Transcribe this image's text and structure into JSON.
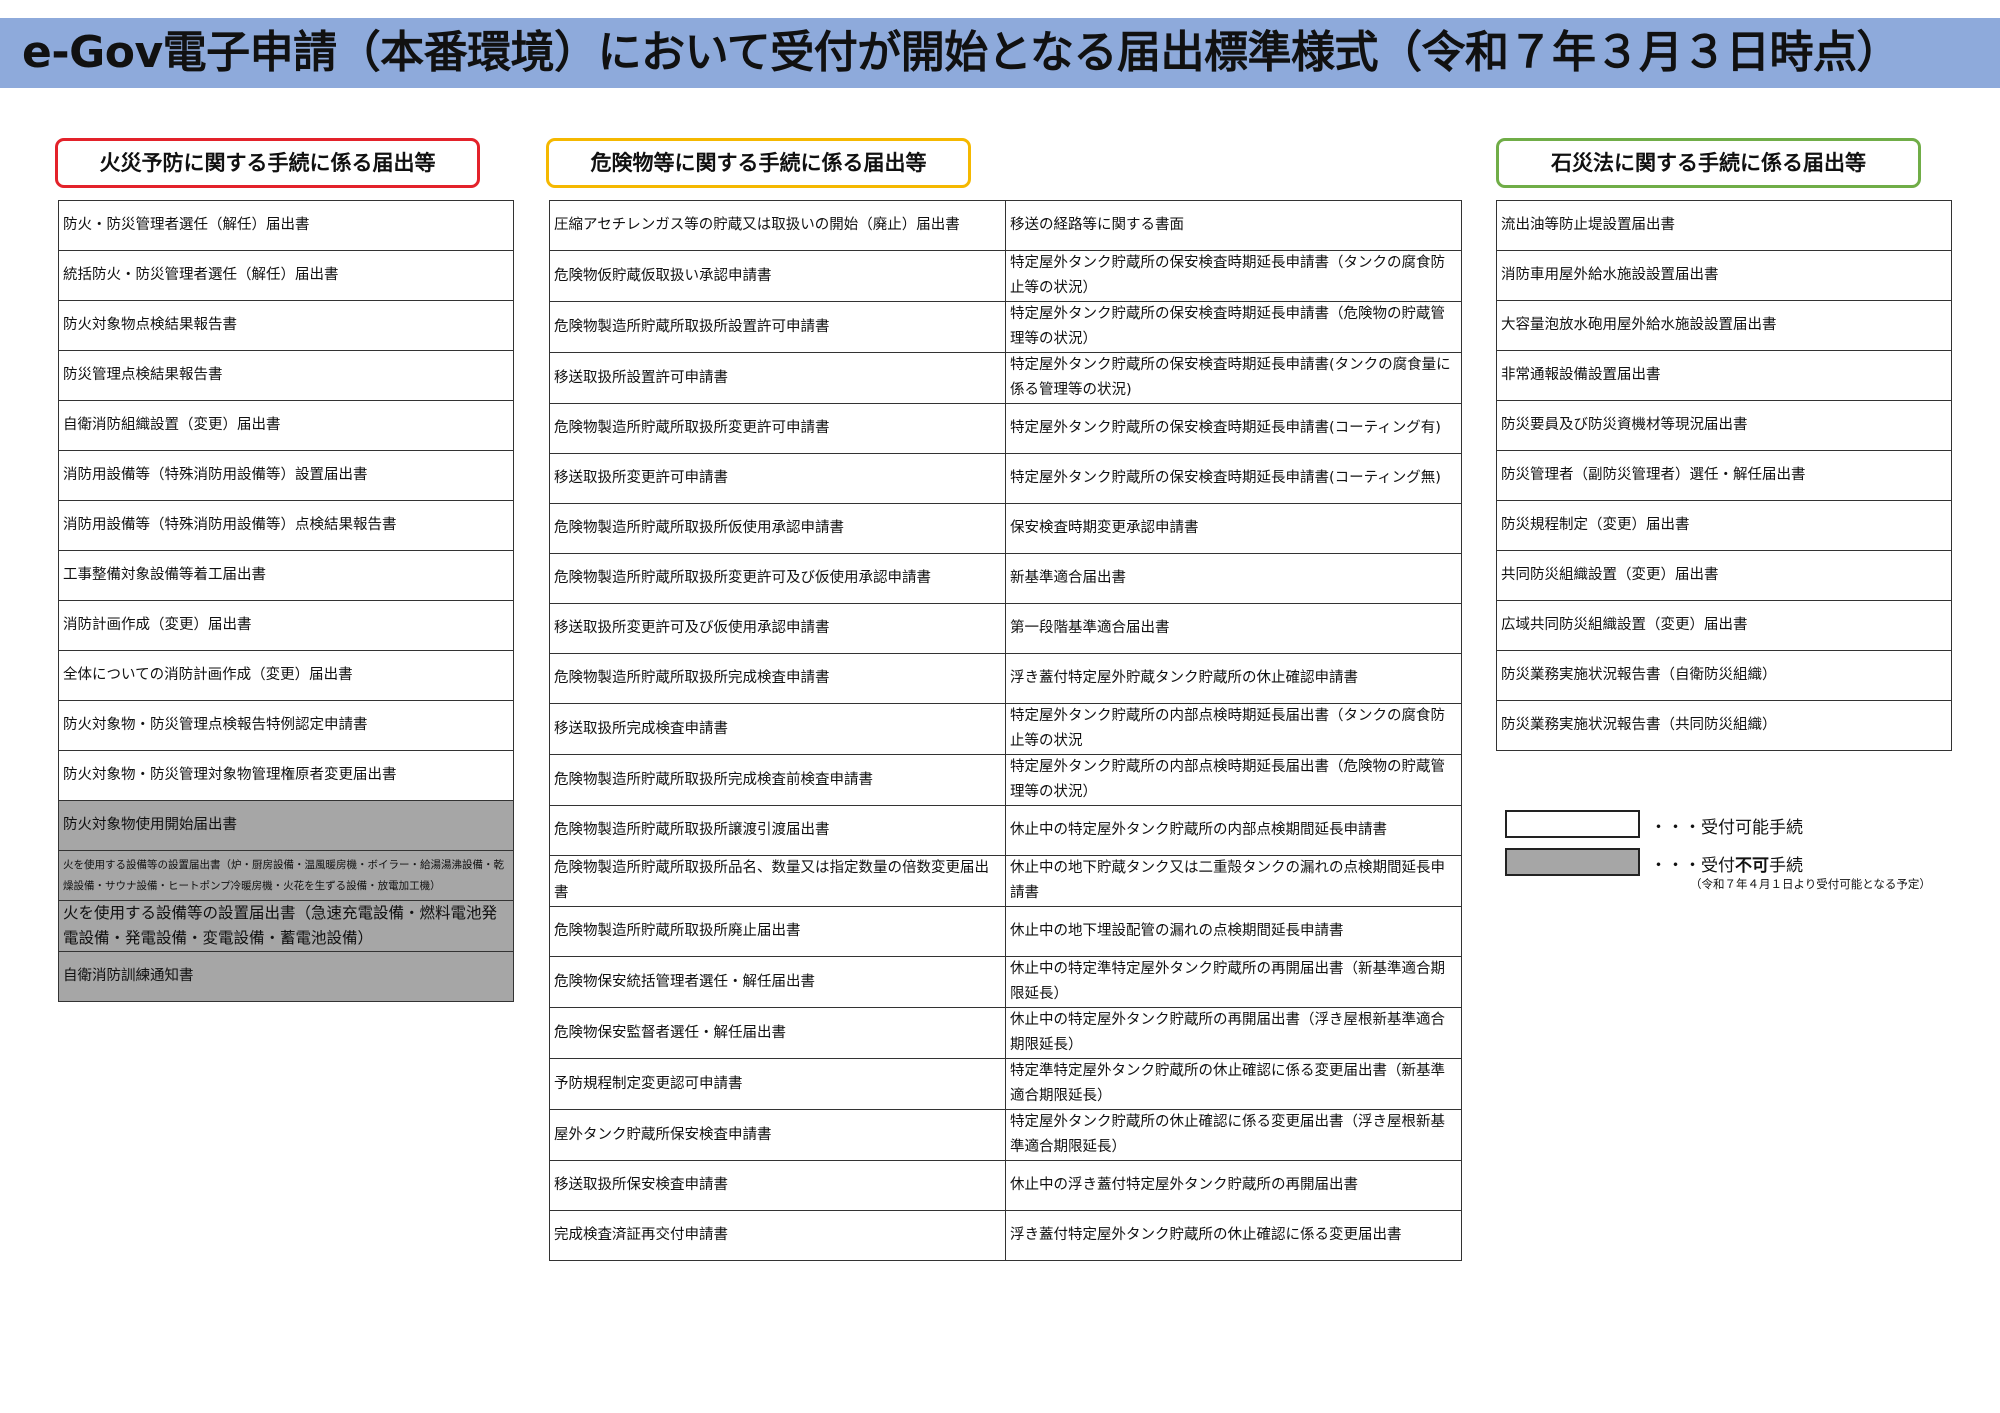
{
  "title": "e-Gov電子申請（本番環境）において受付が開始となる届出標準様式（令和７年３月３日時点）",
  "sections": {
    "fire": {
      "heading": "火災予防に関する手続に係る届出等",
      "border_color": "#e3222a",
      "rows": [
        {
          "text": "防火・防災管理者選任（解任）届出書"
        },
        {
          "text": "統括防火・防災管理者選任（解任）届出書"
        },
        {
          "text": "防火対象物点検結果報告書"
        },
        {
          "text": "防災管理点検結果報告書"
        },
        {
          "text": "自衛消防組織設置（変更）届出書"
        },
        {
          "text": "消防用設備等（特殊消防用設備等）設置届出書"
        },
        {
          "text": "消防用設備等（特殊消防用設備等）点検結果報告書"
        },
        {
          "text": "工事整備対象設備等着工届出書"
        },
        {
          "text": "消防計画作成（変更）届出書"
        },
        {
          "text": "全体についての消防計画作成（変更）届出書"
        },
        {
          "text": "防火対象物・防災管理点検報告特例認定申請書"
        },
        {
          "text": "防火対象物・防災管理対象物管理権原者変更届出書"
        },
        {
          "text": "防火対象物使用開始届出書",
          "accepted": false
        },
        {
          "text": "火を使用する設備等の設置届出書（炉・厨房設備・温風暖房機・ボイラー・給湯湯沸設備・乾燥設備・サウナ設備・ヒートポンプ冷暖房機・火花を生ずる設備・放電加工機）",
          "accepted": false,
          "size": "small"
        },
        {
          "text": "火を使用する設備等の設置届出書（急速充電設備・燃料電池発電設備・発電設備・変電設備・蓄電池設備）",
          "accepted": false,
          "size": "med"
        },
        {
          "text": "自衛消防訓練通知書",
          "accepted": false
        }
      ]
    },
    "hazmat": {
      "heading": "危険物等に関する手続に係る届出等",
      "border_color": "#f5b800",
      "rows": [
        {
          "left": "圧縮アセチレンガス等の貯蔵又は取扱いの開始（廃止）届出書",
          "right": "移送の経路等に関する書面"
        },
        {
          "left": "危険物仮貯蔵仮取扱い承認申請書",
          "right": "特定屋外タンク貯蔵所の保安検査時期延長申請書（タンクの腐食防止等の状況）"
        },
        {
          "left": "危険物製造所貯蔵所取扱所設置許可申請書",
          "right": "特定屋外タンク貯蔵所の保安検査時期延長申請書（危険物の貯蔵管理等の状況）"
        },
        {
          "left": "移送取扱所設置許可申請書",
          "right": "特定屋外タンク貯蔵所の保安検査時期延長申請書(タンクの腐食量に係る管理等の状況)"
        },
        {
          "left": "危険物製造所貯蔵所取扱所変更許可申請書",
          "right": "特定屋外タンク貯蔵所の保安検査時期延長申請書(コーティング有)"
        },
        {
          "left": "移送取扱所変更許可申請書",
          "right": "特定屋外タンク貯蔵所の保安検査時期延長申請書(コーティング無)"
        },
        {
          "left": "危険物製造所貯蔵所取扱所仮使用承認申請書",
          "right": "保安検査時期変更承認申請書"
        },
        {
          "left": "危険物製造所貯蔵所取扱所変更許可及び仮使用承認申請書",
          "right": "新基準適合届出書"
        },
        {
          "left": "移送取扱所変更許可及び仮使用承認申請書",
          "right": "第一段階基準適合届出書"
        },
        {
          "left": "危険物製造所貯蔵所取扱所完成検査申請書",
          "right": "浮き蓋付特定屋外貯蔵タンク貯蔵所の休止確認申請書"
        },
        {
          "left": "移送取扱所完成検査申請書",
          "right": "特定屋外タンク貯蔵所の内部点検時期延長届出書（タンクの腐食防止等の状況"
        },
        {
          "left": "危険物製造所貯蔵所取扱所完成検査前検査申請書",
          "right": "特定屋外タンク貯蔵所の内部点検時期延長届出書（危険物の貯蔵管理等の状況）"
        },
        {
          "left": "危険物製造所貯蔵所取扱所譲渡引渡届出書",
          "right": "休止中の特定屋外タンク貯蔵所の内部点検期間延長申請書"
        },
        {
          "left": "危険物製造所貯蔵所取扱所品名、数量又は指定数量の倍数変更届出書",
          "right": "休止中の地下貯蔵タンク又は二重殻タンクの漏れの点検期間延長申請書"
        },
        {
          "left": "危険物製造所貯蔵所取扱所廃止届出書",
          "right": "休止中の地下埋設配管の漏れの点検期間延長申請書"
        },
        {
          "left": "危険物保安統括管理者選任・解任届出書",
          "right": "休止中の特定準特定屋外タンク貯蔵所の再開届出書（新基準適合期限延長）"
        },
        {
          "left": "危険物保安監督者選任・解任届出書",
          "right": "休止中の特定屋外タンク貯蔵所の再開届出書（浮き屋根新基準適合期限延長）"
        },
        {
          "left": "予防規程制定変更認可申請書",
          "right": "特定準特定屋外タンク貯蔵所の休止確認に係る変更届出書（新基準適合期限延長）"
        },
        {
          "left": "屋外タンク貯蔵所保安検査申請書",
          "right": "特定屋外タンク貯蔵所の休止確認に係る変更届出書（浮き屋根新基準適合期限延長）"
        },
        {
          "left": "移送取扱所保安検査申請書",
          "right": "休止中の浮き蓋付特定屋外タンク貯蔵所の再開届出書"
        },
        {
          "left": "完成検査済証再交付申請書",
          "right": "浮き蓋付特定屋外タンク貯蔵所の休止確認に係る変更届出書"
        }
      ]
    },
    "sekisai": {
      "heading": "石災法に関する手続に係る届出等",
      "border_color": "#70ad47",
      "rows": [
        {
          "text": "流出油等防止堤設置届出書"
        },
        {
          "text": "消防車用屋外給水施設設置届出書"
        },
        {
          "text": "大容量泡放水砲用屋外給水施設設置届出書"
        },
        {
          "text": "非常通報設備設置届出書"
        },
        {
          "text": "防災要員及び防災資機材等現況届出書"
        },
        {
          "text": "防災管理者（副防災管理者）選任・解任届出書"
        },
        {
          "text": "防災規程制定（変更）届出書"
        },
        {
          "text": "共同防災組織設置（変更）届出書"
        },
        {
          "text": "広域共同防災組織設置（変更）届出書"
        },
        {
          "text": "防災業務実施状況報告書（自衛防災組織）"
        },
        {
          "text": "防災業務実施状況報告書（共同防災組織）"
        }
      ]
    }
  },
  "legend": {
    "available_label": "・・・受付可能手続",
    "unavailable_prefix": "・・・受付",
    "unavailable_bold": "不可",
    "unavailable_suffix": "手続",
    "note": "（令和７年４月１日より受付可能となる予定）",
    "available_color": "#ffffff",
    "unavailable_color": "#a6a6a6"
  }
}
